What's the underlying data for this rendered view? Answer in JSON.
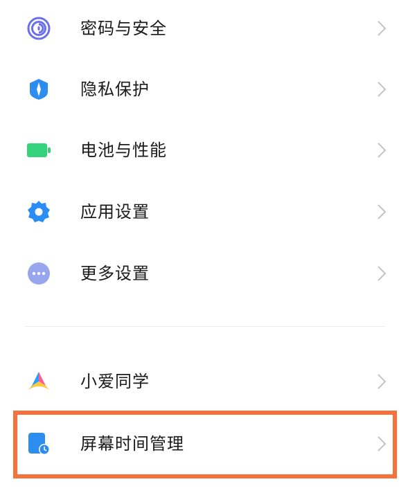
{
  "settings": {
    "items": [
      {
        "label": "密码与安全",
        "icon": "fingerprint-icon",
        "color": "#6b6fe8"
      },
      {
        "label": "隐私保护",
        "icon": "shield-icon",
        "color": "#2d8cf0"
      },
      {
        "label": "电池与性能",
        "icon": "battery-icon",
        "color": "#34d27a"
      },
      {
        "label": "应用设置",
        "icon": "gear-icon",
        "color": "#2a8df5"
      },
      {
        "label": "更多设置",
        "icon": "more-dots-icon",
        "color": "#98a6f0"
      }
    ],
    "items2": [
      {
        "label": "小爱同学",
        "icon": "xiaoai-icon"
      },
      {
        "label": "屏幕时间管理",
        "icon": "screen-time-icon",
        "color": "#2d8cf0"
      }
    ]
  },
  "highlight_color": "#f5703a"
}
